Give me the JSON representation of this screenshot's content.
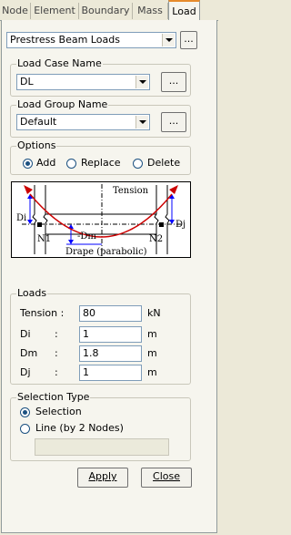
{
  "tabs": [
    "Node",
    "Element",
    "Boundary",
    "Mass",
    "Load"
  ],
  "active_tab": "Load",
  "load_type": {
    "value": "Prestress Beam Loads",
    "more_label": "..."
  },
  "load_case": {
    "legend": "Load Case Name",
    "value": "DL",
    "more_label": "..."
  },
  "load_group": {
    "legend": "Load Group Name",
    "value": "Default",
    "more_label": "..."
  },
  "options": {
    "legend": "Options",
    "items": [
      "Add",
      "Replace",
      "Delete"
    ],
    "selected": "Add"
  },
  "diagram": {
    "tension": "Tension",
    "di": "Di",
    "dj": "Dj",
    "dm": "-Dm",
    "n1": "N1",
    "n2": "N2",
    "drape": "Drape (parabolic)"
  },
  "loads": {
    "legend": "Loads",
    "rows": [
      {
        "label": "Tension :",
        "value": "80",
        "unit": "kN"
      },
      {
        "label": "Di",
        "colon": ":",
        "value": "1",
        "unit": "m"
      },
      {
        "label": "Dm",
        "colon": ":",
        "value": "1.8",
        "unit": "m"
      },
      {
        "label": "Dj",
        "colon": ":",
        "value": "1",
        "unit": "m"
      }
    ]
  },
  "selection": {
    "legend": "Selection Type",
    "items": [
      "Selection",
      "Line (by 2 Nodes)"
    ],
    "selected": "Selection"
  },
  "buttons": {
    "apply": "Apply",
    "close": "Close"
  }
}
